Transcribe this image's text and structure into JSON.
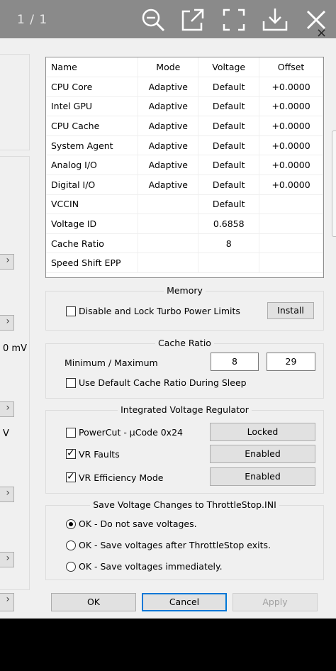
{
  "viewer": {
    "page_count": "1 / 1",
    "icons": [
      "zoom-out-icon",
      "open-external-icon",
      "fullscreen-icon",
      "download-icon",
      "close-icon"
    ]
  },
  "window": {
    "close_glyph": "×"
  },
  "left_fragments": {
    "mv": "0 mV",
    "v": "V"
  },
  "table": {
    "headers": [
      "Name",
      "Mode",
      "Voltage",
      "Offset"
    ],
    "rows": [
      [
        "CPU Core",
        "Adaptive",
        "Default",
        "+0.0000"
      ],
      [
        "Intel GPU",
        "Adaptive",
        "Default",
        "+0.0000"
      ],
      [
        "CPU Cache",
        "Adaptive",
        "Default",
        "+0.0000"
      ],
      [
        "System Agent",
        "Adaptive",
        "Default",
        "+0.0000"
      ],
      [
        "Analog I/O",
        "Adaptive",
        "Default",
        "+0.0000"
      ],
      [
        "Digital I/O",
        "Adaptive",
        "Default",
        "+0.0000"
      ],
      [
        "VCCIN",
        "",
        "Default",
        ""
      ],
      [
        "Voltage ID",
        "",
        "0.6858",
        ""
      ],
      [
        "Cache Ratio",
        "",
        "8",
        ""
      ],
      [
        "Speed Shift EPP",
        "",
        "",
        ""
      ]
    ]
  },
  "memory": {
    "title": "Memory",
    "disable_lock_label": "Disable and Lock Turbo Power Limits",
    "disable_lock_checked": false,
    "install_label": "Install"
  },
  "cache_ratio": {
    "title": "Cache Ratio",
    "min_max_label": "Minimum / Maximum",
    "min_value": "8",
    "max_value": "29",
    "use_default_label": "Use Default Cache Ratio During Sleep",
    "use_default_checked": false
  },
  "ivr": {
    "title": "Integrated Voltage Regulator",
    "powercut_label": "PowerCut  -  µCode 0x24",
    "powercut_checked": false,
    "powercut_status": "Locked",
    "vr_faults_label": "VR Faults",
    "vr_faults_checked": true,
    "vr_faults_status": "Enabled",
    "vr_eff_label": "VR Efficiency Mode",
    "vr_eff_checked": true,
    "vr_eff_status": "Enabled"
  },
  "save": {
    "title": "Save Voltage Changes to ThrottleStop.INI",
    "options": [
      "OK - Do not save voltages.",
      "OK - Save voltages after ThrottleStop exits.",
      "OK - Save voltages immediately."
    ],
    "selected": 0
  },
  "buttons": {
    "ok": "OK",
    "cancel": "Cancel",
    "apply": "Apply"
  }
}
